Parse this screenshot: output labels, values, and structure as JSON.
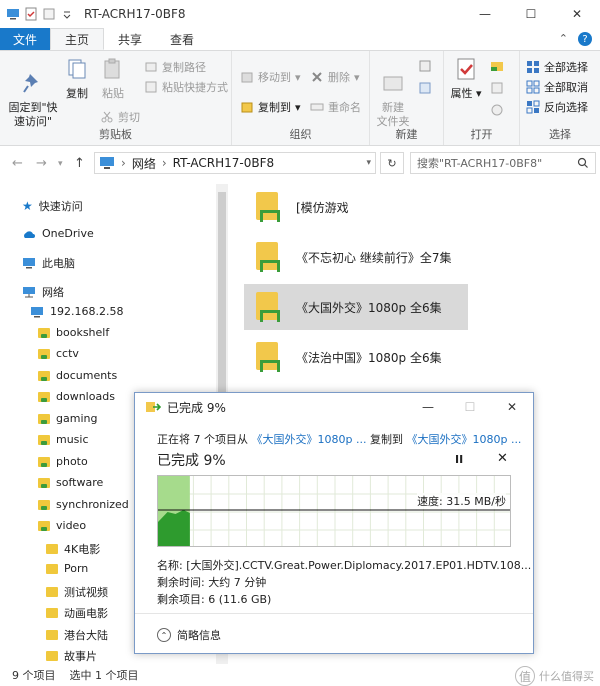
{
  "window": {
    "title": "RT-ACRH17-0BF8",
    "minimize": "—",
    "maximize": "☐",
    "close": "✕"
  },
  "tabs": {
    "file": "文件",
    "home": "主页",
    "share": "共享",
    "view": "查看"
  },
  "ribbon": {
    "clipboard": {
      "label": "剪贴板",
      "pin": "固定到\"快\n速访问\"",
      "copy": "复制",
      "paste": "粘贴",
      "copy_path": "复制路径",
      "paste_shortcut": "粘贴快捷方式",
      "cut": "剪切"
    },
    "organize": {
      "label": "组织",
      "move_to": "移动到",
      "copy_to": "复制到",
      "delete": "删除",
      "rename": "重命名"
    },
    "new": {
      "label": "新建",
      "new_folder": "新建\n文件夹"
    },
    "open": {
      "label": "打开",
      "properties": "属性"
    },
    "select": {
      "label": "选择",
      "select_all": "全部选择",
      "select_none": "全部取消",
      "invert": "反向选择"
    }
  },
  "address": {
    "path": [
      "网络",
      "RT-ACRH17-0BF8"
    ],
    "search_placeholder": "搜索\"RT-ACRH17-0BF8\""
  },
  "nav": {
    "quick_access": "快速访问",
    "onedrive": "OneDrive",
    "this_pc": "此电脑",
    "network": "网络",
    "host": "192.168.2.58",
    "folders": [
      "bookshelf",
      "cctv",
      "documents",
      "downloads",
      "gaming",
      "music",
      "photo",
      "software",
      "synchronized",
      "video"
    ],
    "video_sub": [
      "4K电影",
      "Porn",
      "测试视频",
      "动画电影",
      "港台大陆",
      "故事片"
    ]
  },
  "files": [
    {
      "name": "[模仿游戏",
      "selected": false
    },
    {
      "name": "《不忘初心 继续前行》全7集",
      "selected": false
    },
    {
      "name": "《大国外交》1080p 全6集",
      "selected": true
    },
    {
      "name": "《法治中国》1080p 全6集",
      "selected": false
    }
  ],
  "status": {
    "count": "9 个项目",
    "selected": "选中 1 个项目"
  },
  "watermark": {
    "icon": "值",
    "text": "什么值得买"
  },
  "dialog": {
    "title": "已完成 9%",
    "line_prefix": "正在将 7 个项目从",
    "from": "《大国外交》1080p ...",
    "copy_to": "复制到",
    "to": "《大国外交》1080p ...",
    "percent_text": "已完成 9%",
    "percent": 9,
    "pause": "II",
    "stop": "✕",
    "speed": "速度: 31.5 MB/秒",
    "name": "名称: [大国外交].CCTV.Great.Power.Diplomacy.2017.EP01.HDTV.108...",
    "time_left": "剩余时间: 大约 7 分钟",
    "items_left": "剩余项目: 6 (11.6 GB)",
    "fewer_details": "简略信息"
  },
  "colors": {
    "accent": "#1979ca",
    "graph_fill": "#a6db8c",
    "graph_line": "#2e9b2e",
    "selected": "#d9d9d9"
  }
}
